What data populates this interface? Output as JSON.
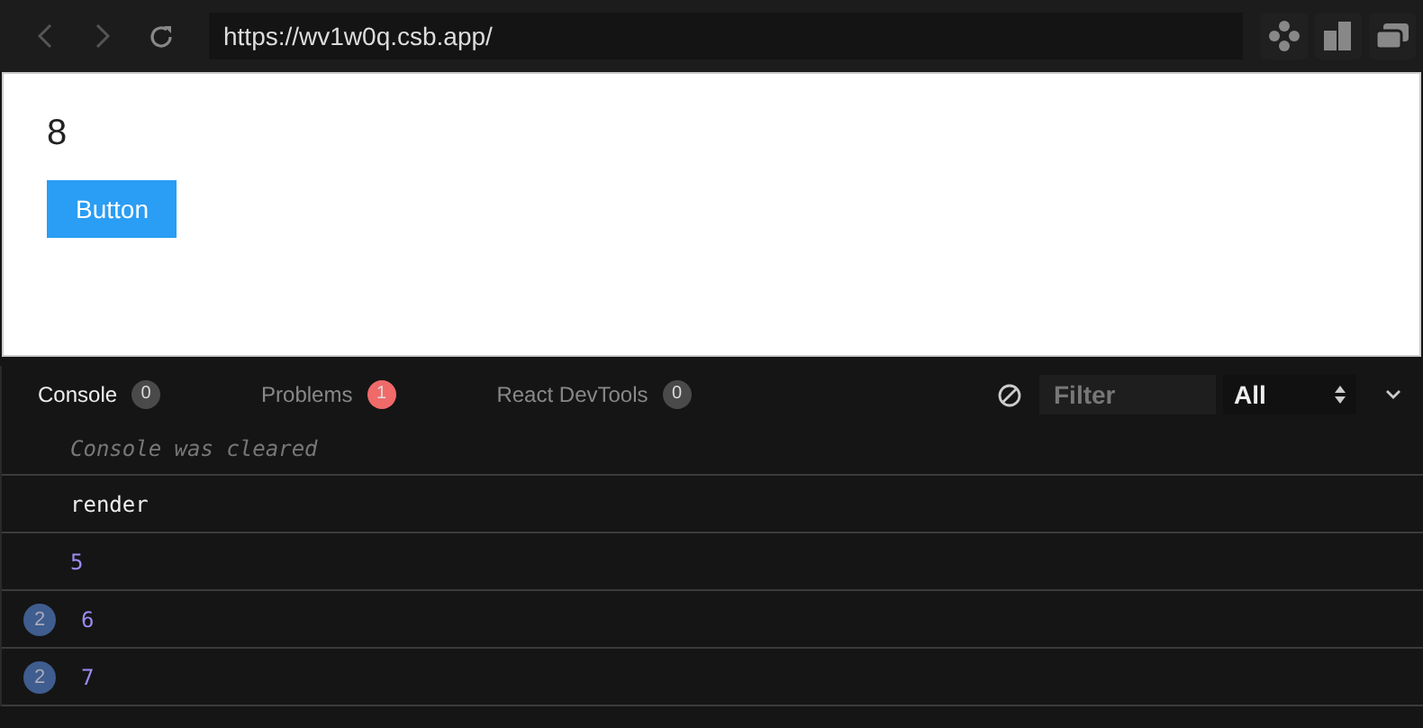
{
  "address_bar": {
    "url": "https://wv1w0q.csb.app/"
  },
  "preview": {
    "counter": "8",
    "button": "Button"
  },
  "devtools": {
    "tabs": [
      {
        "label": "Console",
        "count": "0",
        "selected": true,
        "color": "#4a4a4a"
      },
      {
        "label": "Problems",
        "count": "1",
        "selected": false,
        "color": "#f06a6a"
      },
      {
        "label": "React DevTools",
        "count": "0",
        "selected": false,
        "color": "#4a4a4a"
      }
    ],
    "filter": {
      "placeholder": "Filter"
    },
    "level_select": {
      "value": "All"
    },
    "log": [
      {
        "kind": "info",
        "text": "Console was cleared"
      },
      {
        "kind": "string",
        "text": "render"
      },
      {
        "kind": "number",
        "text": "5"
      },
      {
        "kind": "number",
        "text": "6",
        "repeat": "2"
      },
      {
        "kind": "number",
        "text": "7",
        "repeat": "2"
      }
    ]
  }
}
